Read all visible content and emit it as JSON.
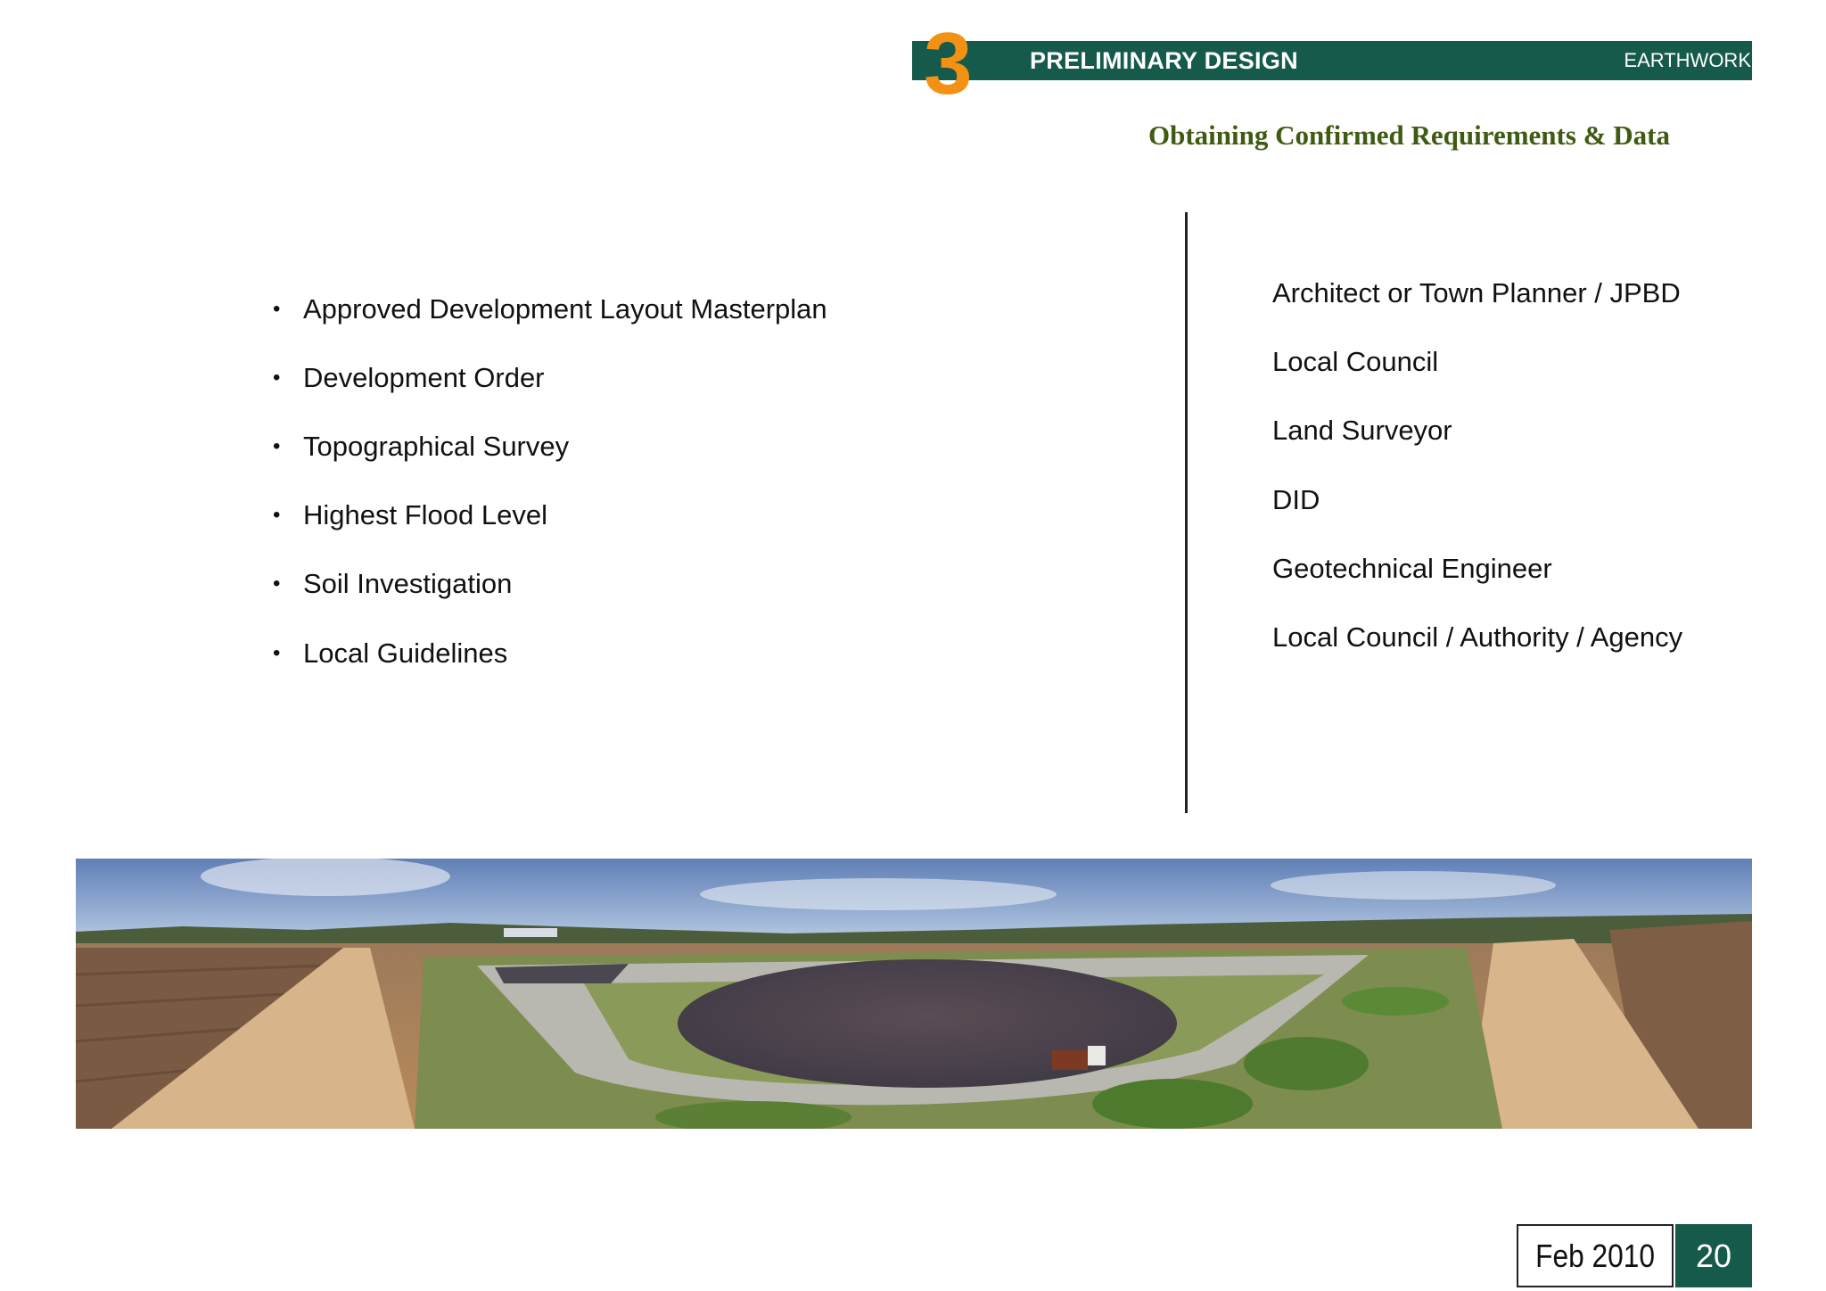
{
  "header": {
    "section_number": "3",
    "section_title": "PRELIMINARY DESIGN",
    "section_tag": "EARTHWORK",
    "subtitle": "Obtaining Confirmed Requirements & Data"
  },
  "requirements": [
    {
      "label": "Approved Development Layout Masterplan",
      "source": "Architect or Town Planner / JPBD"
    },
    {
      "label": "Development Order",
      "source": "Local Council"
    },
    {
      "label": "Topographical Survey",
      "source": "Land Surveyor"
    },
    {
      "label": "Highest Flood Level",
      "source": "DID"
    },
    {
      "label": "Soil Investigation",
      "source": "Geotechnical Engineer"
    },
    {
      "label": "Local Guidelines",
      "source": "Local Council / Authority / Agency"
    }
  ],
  "bullet_symbol": "•",
  "footer": {
    "date": "Feb 2010",
    "page_number": "20"
  },
  "colors": {
    "header_green": "#155a4a",
    "number_orange": "#f29114",
    "subtitle_olive": "#3f5b12"
  }
}
